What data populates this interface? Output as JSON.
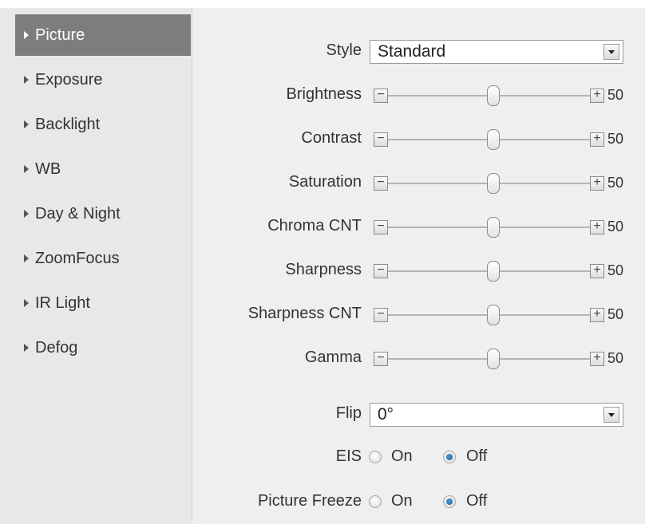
{
  "sidebar": {
    "items": [
      {
        "label": "Picture",
        "active": true
      },
      {
        "label": "Exposure"
      },
      {
        "label": "Backlight"
      },
      {
        "label": "WB"
      },
      {
        "label": "Day & Night"
      },
      {
        "label": "ZoomFocus"
      },
      {
        "label": "IR Light"
      },
      {
        "label": "Defog"
      }
    ]
  },
  "form": {
    "style": {
      "label": "Style",
      "value": "Standard"
    },
    "sliders": [
      {
        "label": "Brightness",
        "value": "50"
      },
      {
        "label": "Contrast",
        "value": "50"
      },
      {
        "label": "Saturation",
        "value": "50"
      },
      {
        "label": "Chroma CNT",
        "value": "50"
      },
      {
        "label": "Sharpness",
        "value": "50"
      },
      {
        "label": "Sharpness CNT",
        "value": "50"
      },
      {
        "label": "Gamma",
        "value": "50"
      }
    ],
    "slider_controls": {
      "minus": "−",
      "plus": "+"
    },
    "flip": {
      "label": "Flip",
      "value": "0°"
    },
    "eis": {
      "label": "EIS",
      "on": "On",
      "off": "Off",
      "selected": "Off"
    },
    "freeze": {
      "label": "Picture Freeze",
      "on": "On",
      "off": "Off",
      "selected": "Off"
    }
  },
  "colors": {
    "active_bg": "#7d7d7d",
    "radio_selected": "#1d5e96"
  }
}
